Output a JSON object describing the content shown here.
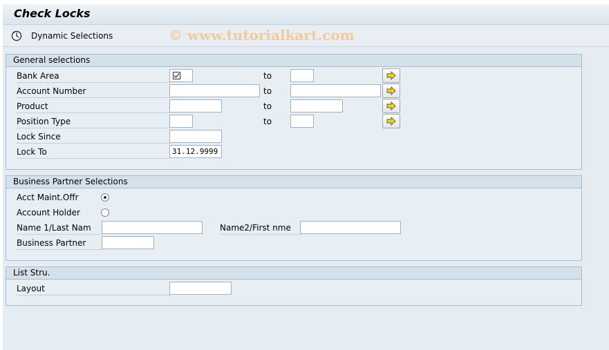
{
  "window": {
    "title": "Check Locks"
  },
  "toolbar": {
    "dynamic_selections": "Dynamic Selections"
  },
  "watermark": "© www.tutorialkart.com",
  "general": {
    "title": "General selections",
    "to_label": "to",
    "rows": [
      {
        "label": "Bank Area",
        "from": "",
        "to": "",
        "checked": true
      },
      {
        "label": "Account Number",
        "from": "",
        "to": ""
      },
      {
        "label": "Product",
        "from": "",
        "to": ""
      },
      {
        "label": "Position Type",
        "from": "",
        "to": ""
      },
      {
        "label": "Lock Since",
        "value": ""
      },
      {
        "label": "Lock To",
        "value": "31.12.9999"
      }
    ]
  },
  "bp": {
    "title": "Business Partner Selections",
    "radio1_label": "Acct Maint.Offr",
    "radio2_label": "Account Holder",
    "radio_selected": "Acct Maint.Offr",
    "name1_label": "Name 1/Last Nam",
    "name1_value": "",
    "name2_label": "Name2/First nme",
    "name2_value": "",
    "partner_label": "Business Partner",
    "partner_value": ""
  },
  "list": {
    "title": "List Stru.",
    "layout_label": "Layout",
    "layout_value": ""
  },
  "icons": {
    "dynamic_selections": "dynamic-selections-icon",
    "multiple_selection": "multiple-selection-arrow-icon"
  },
  "colors": {
    "arrow_fill": "#f5d800",
    "group_header": "#d5e1ea",
    "background": "#e5edf3"
  }
}
